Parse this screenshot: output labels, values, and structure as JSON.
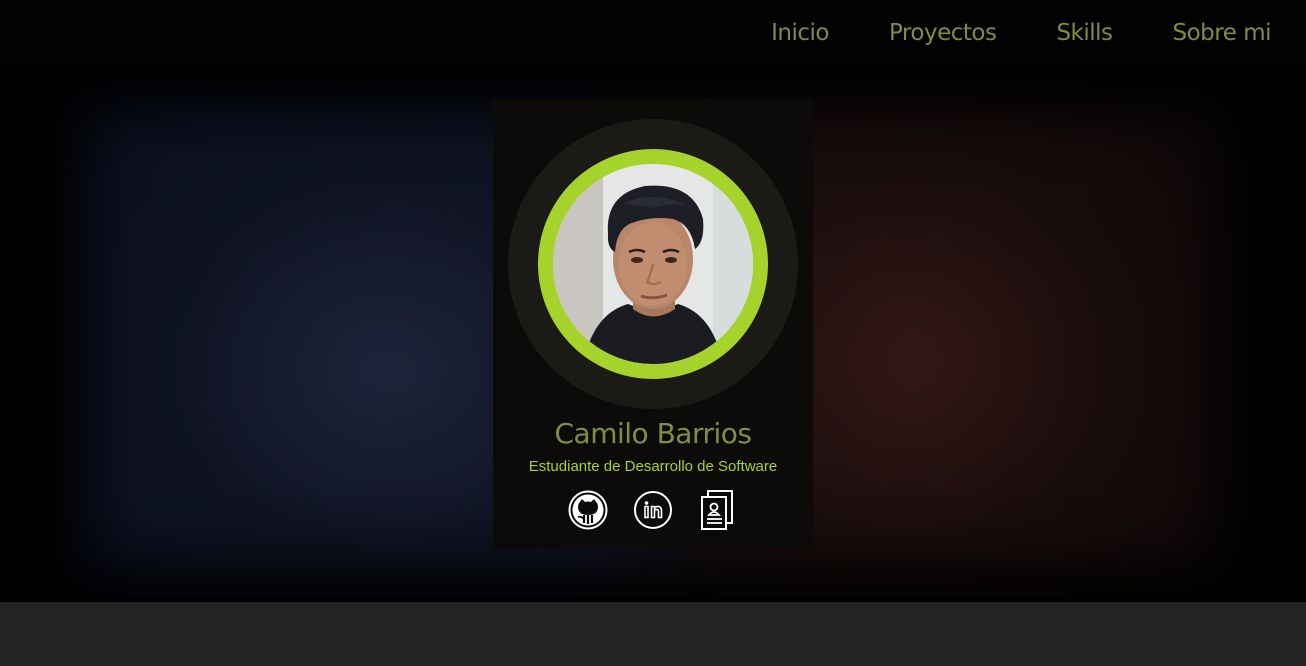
{
  "nav": {
    "items": [
      {
        "label": "Inicio"
      },
      {
        "label": "Proyectos"
      },
      {
        "label": "Skills"
      },
      {
        "label": "Sobre mi"
      }
    ]
  },
  "profile": {
    "name": "Camilo Barrios",
    "subtitle": "Estudiante de Desarrollo de Software",
    "photo_alt": "profile-photo"
  },
  "socials": [
    {
      "icon": "github-icon"
    },
    {
      "icon": "linkedin-icon"
    },
    {
      "icon": "document-icon"
    }
  ],
  "colors": {
    "accent": "#a6d22c",
    "nav_text": "#7d8e3e",
    "name_text": "#7f8f3f"
  }
}
